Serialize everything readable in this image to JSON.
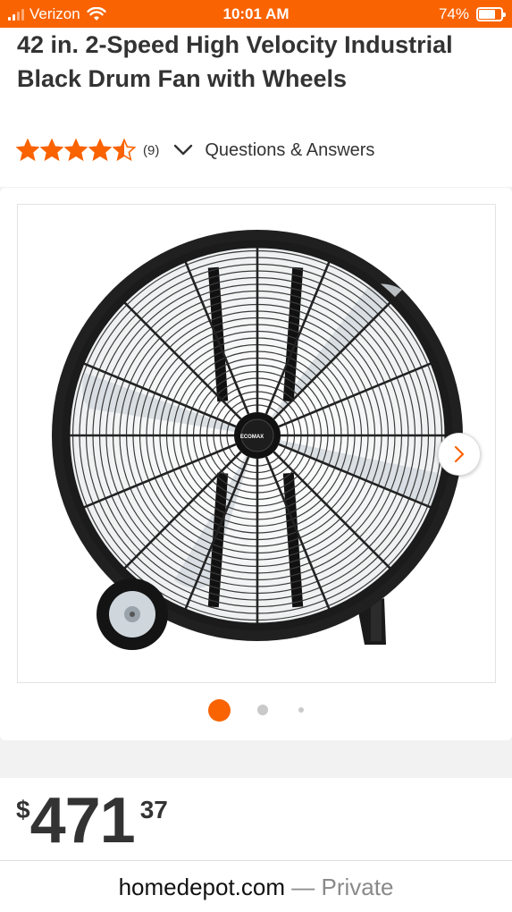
{
  "status_bar": {
    "carrier": "Verizon",
    "time": "10:01 AM",
    "battery": "74%",
    "battery_level": 0.74
  },
  "product": {
    "title": "42 in. 2-Speed High Velocity Industrial Black Drum Fan with Wheels",
    "rating": 4.5,
    "review_count": "(9)",
    "questions_link": "Questions & Answers"
  },
  "gallery": {
    "image_count": 3,
    "active_index": 0,
    "hub_logo_text": "ECOMAX"
  },
  "price": {
    "currency": "$",
    "dollars": "471",
    "cents": "37"
  },
  "address_bar": {
    "domain": "homedepot.com",
    "mode": " — Private"
  },
  "colors": {
    "brand_orange": "#f96302",
    "star": "#f96302",
    "text": "#333333"
  }
}
